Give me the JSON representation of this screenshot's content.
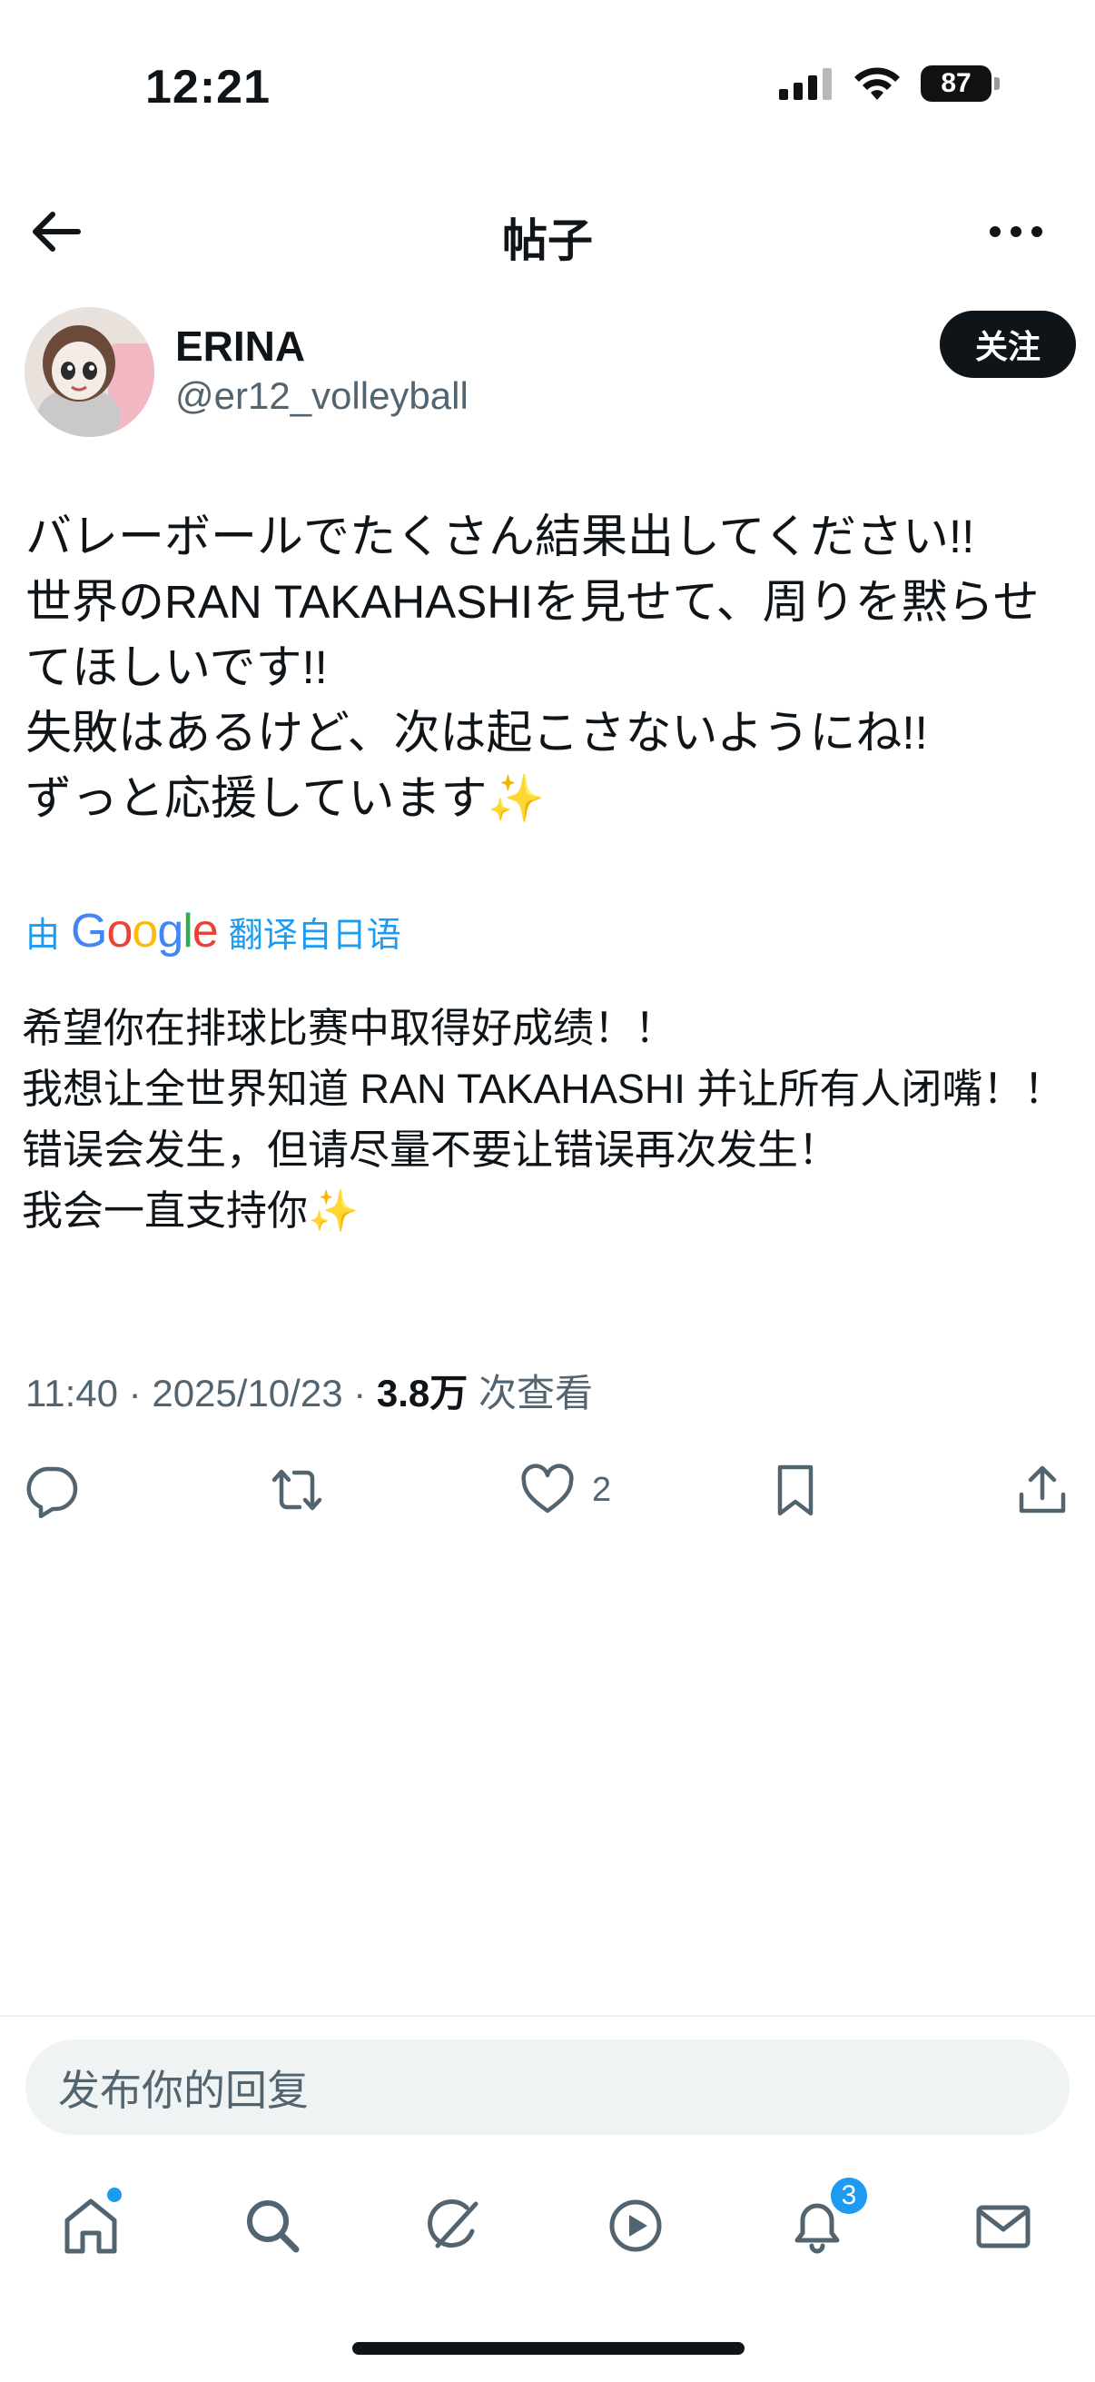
{
  "status_bar": {
    "time": "12:21",
    "battery": "87",
    "icons": [
      "cellular-signal-icon",
      "wifi-icon",
      "battery-icon"
    ]
  },
  "header": {
    "title": "帖子",
    "back_icon": "arrow-left-icon",
    "more_icon": "more-horizontal-icon"
  },
  "post": {
    "author_name": "ERINA",
    "author_handle": "@er12_volleyball",
    "follow_label": "关注",
    "text": "バレーボールでたくさん結果出してください!!\n世界のRAN TAKAHASHIを見せて、周りを黙らせてほしいです!!\n失敗はあるけど、次は起こさないようにね!!\nずっと応援しています✨",
    "translation_prefix": "由",
    "translation_brand": "Google",
    "translation_suffix": "翻译自日语",
    "translation": "希望你在排球比赛中取得好成绩！！\n我想让全世界知道 RAN TAKAHASHI 并让所有人闭嘴！！\n错误会发生，但请尽量不要让错误再次发生！\n我会一直支持你✨",
    "time": "11:40",
    "date": "2025/10/23",
    "separator": "·",
    "views_count": "3.8万",
    "views_label": "次查看",
    "likes": "2"
  },
  "actions": [
    {
      "name": "reply",
      "icon": "reply-icon"
    },
    {
      "name": "repost",
      "icon": "repost-icon"
    },
    {
      "name": "like",
      "icon": "heart-icon"
    },
    {
      "name": "bookmark",
      "icon": "bookmark-icon"
    },
    {
      "name": "share",
      "icon": "share-icon"
    }
  ],
  "reply": {
    "placeholder": "发布你的回复"
  },
  "tabbar": {
    "items": [
      "home-icon",
      "search-icon",
      "grok-icon",
      "video-icon",
      "notifications-icon",
      "messages-icon"
    ],
    "notifications_badge": "3"
  },
  "colors": {
    "accent": "#1d9bf0",
    "text": "#0f1419",
    "secondary": "#536471",
    "reply_bg": "#eff3f4"
  }
}
